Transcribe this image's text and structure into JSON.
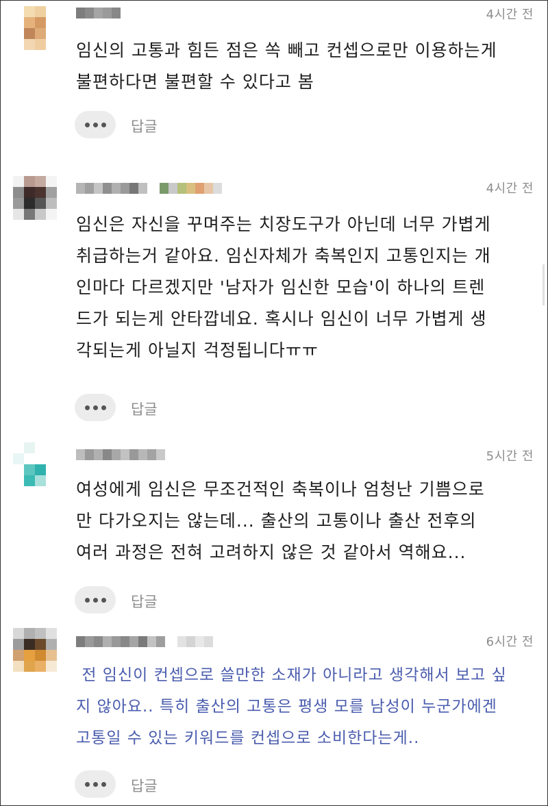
{
  "comments": [
    {
      "time": "4시간 전",
      "text": "임신의 고통과 힘든 점은 쏙 빼고 컨셉으로만 이용하는게\n불편하다면 불편할 수 있다고 봄",
      "more_icon": "ellipsis-icon",
      "reply_label": "답글",
      "highlighted": false
    },
    {
      "time": "4시간 전",
      "text": "임신은 자신을 꾸며주는 치장도구가 아닌데 너무 가볍게\n취급하는거 같아요. 임신자체가 축복인지 고통인지는 개\n인마다 다르겠지만 '남자가 임신한 모습'이 하나의 트렌\n드가 되는게 안타깝네요. 혹시나 임신이 너무 가볍게 생\n각되는게 아닐지 걱정됩니다ㅠㅠ",
      "more_icon": "ellipsis-icon",
      "reply_label": "답글",
      "highlighted": false
    },
    {
      "time": "5시간 전",
      "text": "여성에게 임신은 무조건적인 축복이나 엄청난 기쁨으로\n만 다가오지는 않는데... 출산의 고통이나 출산 전후의\n여러 과정은 전혀 고려하지 않은 것 같아서 역해요...",
      "more_icon": "ellipsis-icon",
      "reply_label": "답글",
      "highlighted": false
    },
    {
      "time": "6시간 전",
      "text": " 전 임신이 컨셉으로 쓸만한 소재가 아니라고 생각해서 보고 싶\n지 않아요.. 특히 출산의 고통은 평생 모를 남성이 누군가에겐\n고통일 수 있는 키워드를 컨셉으로 소비한다는게..",
      "more_icon": "ellipsis-icon",
      "reply_label": "답글",
      "highlighted": true
    }
  ],
  "colors": {
    "text": "#1e1e1e",
    "highlight_text": "#4a5cae",
    "meta": "#8c8c8c",
    "button_bg": "#ececec"
  }
}
